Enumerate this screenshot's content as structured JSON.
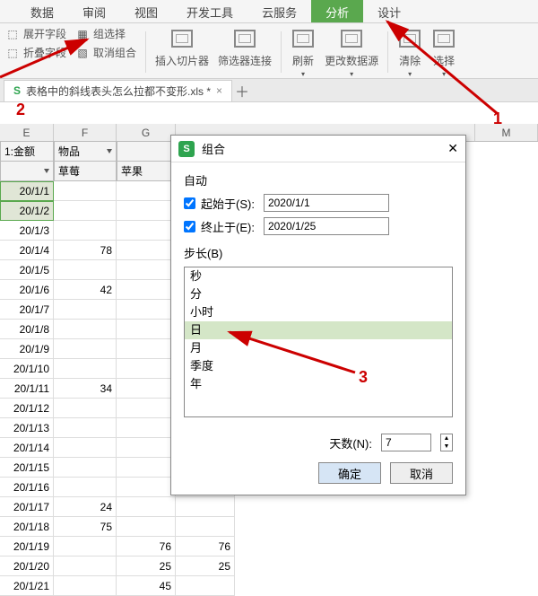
{
  "ribbon_tabs": [
    "数据",
    "审阅",
    "视图",
    "开发工具",
    "云服务",
    "分析",
    "设计"
  ],
  "active_tab_index": 5,
  "ribbon": {
    "expand_field": "展开字段",
    "collapse_field": "折叠字段",
    "group_select": "组选择",
    "ungroup": "取消组合",
    "slicer": "插入切片器",
    "filter_conn": "筛选器连接",
    "refresh": "刷新",
    "change_src": "更改数据源",
    "clear": "清除",
    "select": "选择"
  },
  "doc_tab": {
    "name": "表格中的斜线表头怎么拉都不变形.xls *"
  },
  "col_headers": [
    "E",
    "F",
    "G",
    "M"
  ],
  "pivot": {
    "value_label": "1:金额",
    "field_label": "物品",
    "first_item": "草莓",
    "second_item": "苹果"
  },
  "rows": [
    {
      "date": "20/1/1",
      "f": "",
      "g": ""
    },
    {
      "date": "20/1/2",
      "f": "",
      "g": ""
    },
    {
      "date": "20/1/3",
      "f": "",
      "g": ""
    },
    {
      "date": "20/1/4",
      "f": "78",
      "g": ""
    },
    {
      "date": "20/1/5",
      "f": "",
      "g": ""
    },
    {
      "date": "20/1/6",
      "f": "42",
      "g": ""
    },
    {
      "date": "20/1/7",
      "f": "",
      "g": ""
    },
    {
      "date": "20/1/8",
      "f": "",
      "g": ""
    },
    {
      "date": "20/1/9",
      "f": "",
      "g": ""
    },
    {
      "date": "20/1/10",
      "f": "",
      "g": ""
    },
    {
      "date": "20/1/11",
      "f": "34",
      "g": ""
    },
    {
      "date": "20/1/12",
      "f": "",
      "g": ""
    },
    {
      "date": "20/1/13",
      "f": "",
      "g": ""
    },
    {
      "date": "20/1/14",
      "f": "",
      "g": ""
    },
    {
      "date": "20/1/15",
      "f": "",
      "g": ""
    },
    {
      "date": "20/1/16",
      "f": "",
      "g": ""
    },
    {
      "date": "20/1/17",
      "f": "24",
      "g": ""
    },
    {
      "date": "20/1/18",
      "f": "75",
      "g": ""
    },
    {
      "date": "20/1/19",
      "f": "",
      "g": "76",
      "h": "76"
    },
    {
      "date": "20/1/20",
      "f": "",
      "g": "25",
      "h": "25"
    },
    {
      "date": "20/1/21",
      "f": "",
      "g": "45",
      "h": ""
    }
  ],
  "dialog": {
    "title": "组合",
    "auto_label": "自动",
    "start_label": "起始于(S):",
    "end_label": "终止于(E):",
    "start_value": "2020/1/1",
    "end_value": "2020/1/25",
    "step_label": "步长(B)",
    "step_items": [
      "秒",
      "分",
      "小时",
      "日",
      "月",
      "季度",
      "年"
    ],
    "step_selected_index": 3,
    "days_label": "天数(N):",
    "days_value": "7",
    "ok": "确定",
    "cancel": "取消"
  },
  "annotations": {
    "n1": "1",
    "n2": "2",
    "n3": "3"
  }
}
